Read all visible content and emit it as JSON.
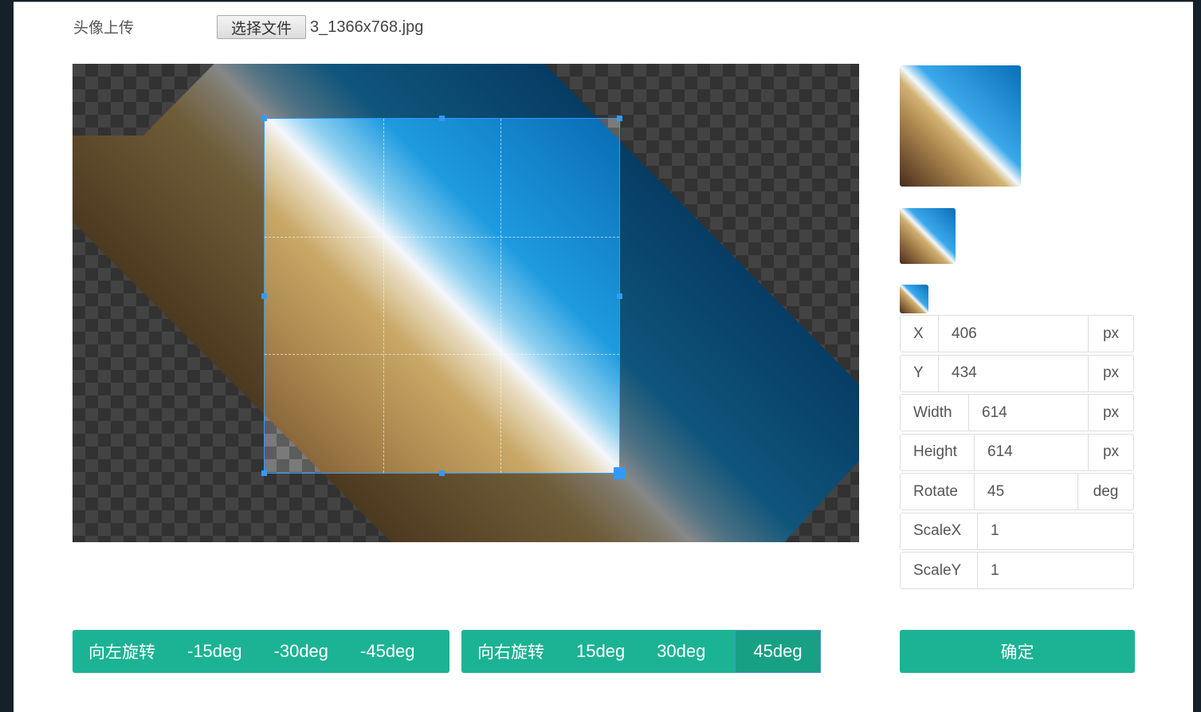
{
  "upload": {
    "label": "头像上传",
    "choose_button": "选择文件",
    "file_name": "3_1366x768.jpg"
  },
  "fields": [
    {
      "key": "X",
      "value": "406",
      "unit": "px"
    },
    {
      "key": "Y",
      "value": "434",
      "unit": "px"
    },
    {
      "key": "Width",
      "value": "614",
      "unit": "px"
    },
    {
      "key": "Height",
      "value": "614",
      "unit": "px"
    },
    {
      "key": "Rotate",
      "value": "45",
      "unit": "deg"
    },
    {
      "key": "ScaleX",
      "value": "1",
      "unit": ""
    },
    {
      "key": "ScaleY",
      "value": "1",
      "unit": ""
    }
  ],
  "rotate_left": {
    "label": "向左旋转",
    "options": [
      "-15deg",
      "-30deg",
      "-45deg"
    ]
  },
  "rotate_right": {
    "label": "向右旋转",
    "options": [
      "15deg",
      "30deg",
      "45deg"
    ]
  },
  "confirm": "确定",
  "colors": {
    "accent": "#1bb394",
    "crop_border": "#3399ff"
  }
}
